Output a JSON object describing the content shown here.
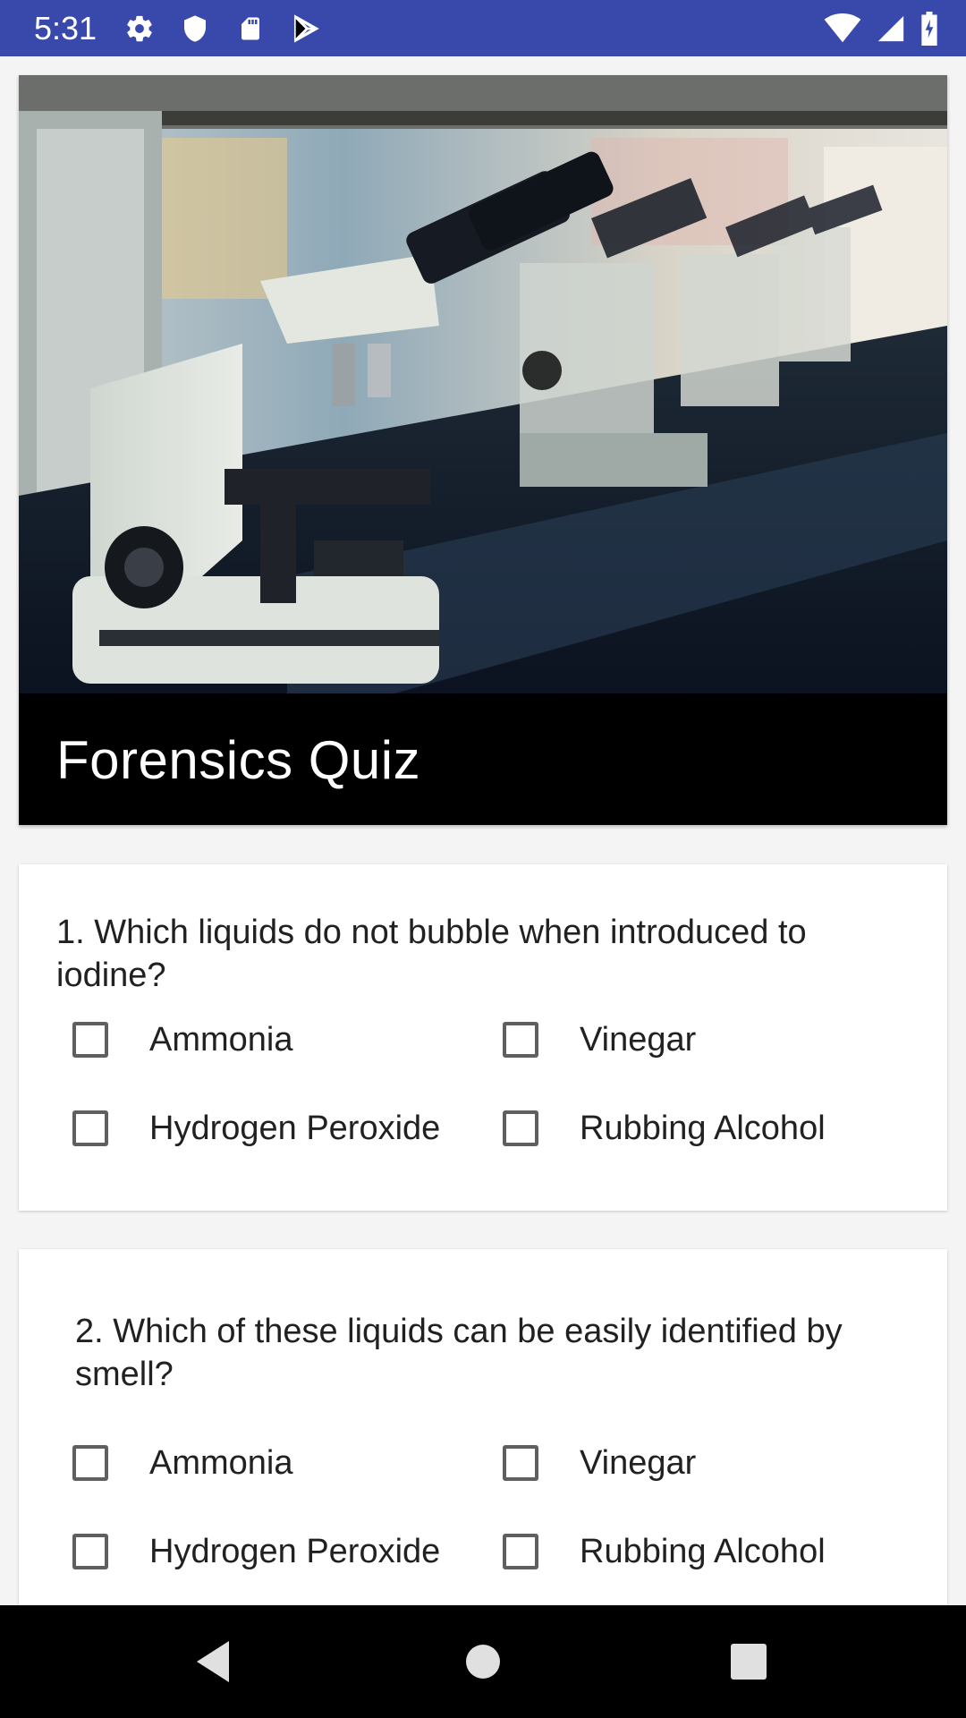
{
  "status_bar": {
    "time": "5:31",
    "icons_left": [
      "gear-icon",
      "shield-icon",
      "sd-card-icon",
      "play-store-icon"
    ],
    "icons_right": [
      "wifi-icon",
      "cell-signal-icon",
      "battery-icon"
    ]
  },
  "header": {
    "image": "microscopes-lab-photo",
    "title": "Forensics Quiz"
  },
  "questions": [
    {
      "text": "1. Which liquids do not bubble when introduced to iodine?",
      "options": [
        "Ammonia",
        "Vinegar",
        "Hydrogen Peroxide",
        "Rubbing Alcohol"
      ],
      "checked": [
        false,
        false,
        false,
        false
      ]
    },
    {
      "text": "2. Which of these liquids can be easily identified by smell?",
      "options": [
        "Ammonia",
        "Vinegar",
        "Hydrogen Peroxide",
        "Rubbing Alcohol"
      ],
      "checked": [
        false,
        false,
        false,
        false
      ]
    }
  ],
  "nav_bar": {
    "buttons": [
      "back-icon",
      "home-icon",
      "recents-icon"
    ]
  },
  "colors": {
    "status_bar": "#3949ab",
    "title_bg": "#000000",
    "background": "#f4f4f4",
    "checkbox_border": "#5f5f5f"
  }
}
